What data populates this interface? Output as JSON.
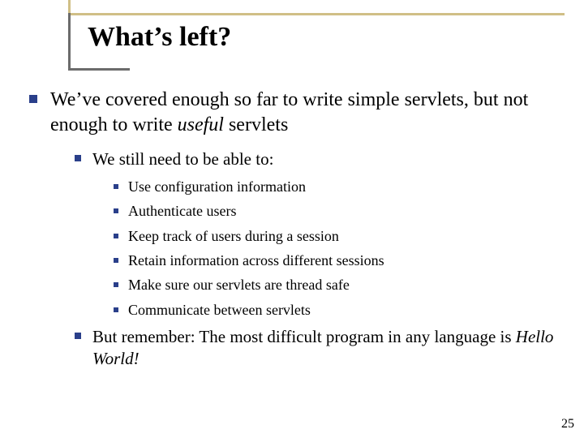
{
  "title": "What’s left?",
  "point1_a": "We’ve covered enough so far to write simple servlets, but not enough to write ",
  "point1_b": "useful",
  "point1_c": " servlets",
  "sub1": "We still need to be able to:",
  "items": [
    "Use configuration information",
    "Authenticate users",
    "Keep track of users during a session",
    "Retain information across different sessions",
    "Make sure our servlets are thread safe",
    "Communicate between servlets"
  ],
  "sub2_a": "But remember: The most difficult program in any language is ",
  "sub2_b": "Hello World!",
  "page_number": "25"
}
